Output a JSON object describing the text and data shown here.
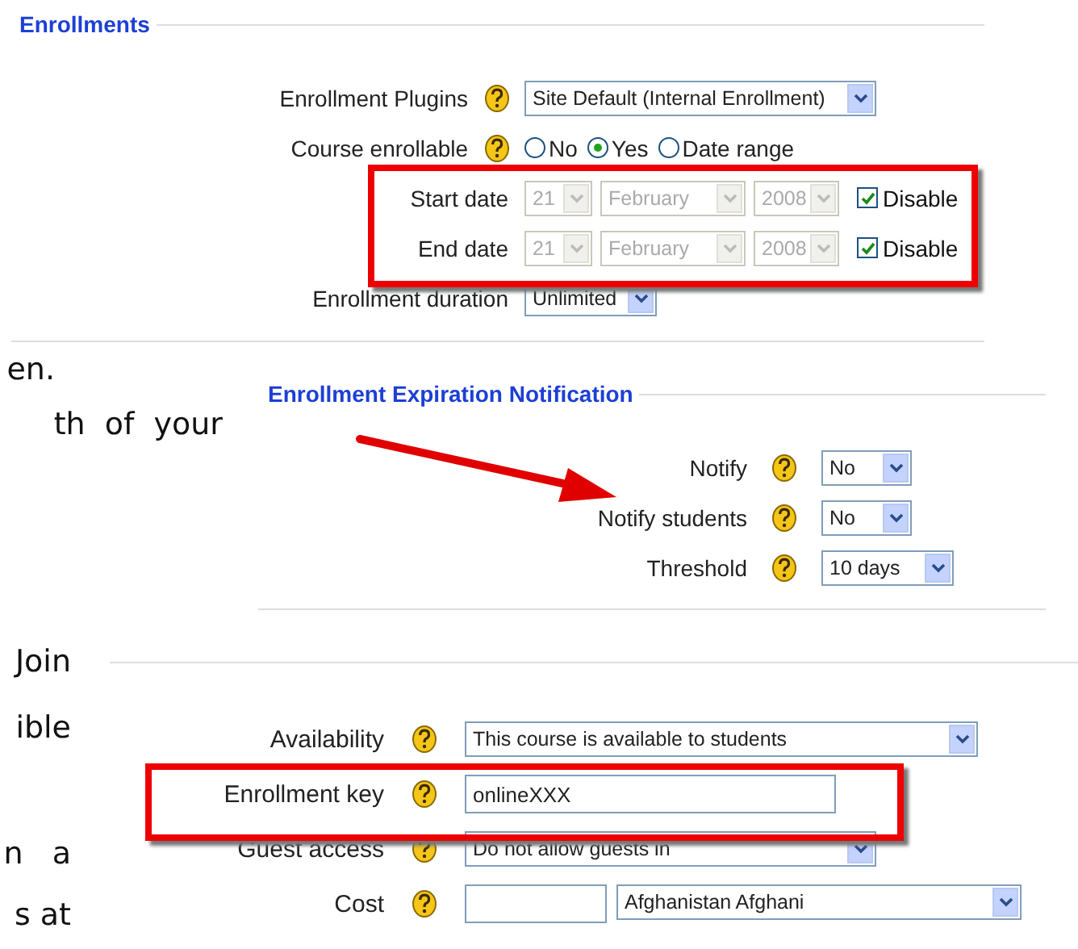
{
  "enrollments": {
    "legend": "Enrollments",
    "plugins": {
      "label": "Enrollment Plugins",
      "value": "Site Default (Internal Enrollment)"
    },
    "enrollable": {
      "label": "Course enrollable",
      "options": [
        {
          "label": "No",
          "selected": false
        },
        {
          "label": "Yes",
          "selected": true
        },
        {
          "label": "Date range",
          "selected": false
        }
      ]
    },
    "dates": [
      {
        "label": "Start date",
        "day": "21",
        "month": "February",
        "year": "2008",
        "disable": {
          "label": "Disable",
          "checked": true
        }
      },
      {
        "label": "End date",
        "day": "21",
        "month": "February",
        "year": "2008",
        "disable": {
          "label": "Disable",
          "checked": true
        }
      }
    ],
    "duration": {
      "label": "Enrollment duration",
      "value": "Unlimited"
    }
  },
  "document_text": [
    "en.",
    "th  of  your",
    "Join",
    "ible",
    "n   a",
    "s at"
  ],
  "expiration": {
    "legend": "Enrollment Expiration Notification",
    "rows": [
      {
        "label": "Notify",
        "value": "No"
      },
      {
        "label": "Notify students",
        "value": "No"
      },
      {
        "label": "Threshold",
        "value": "10 days"
      }
    ]
  },
  "course_settings": {
    "rows": [
      {
        "kind": "select",
        "label": "Availability",
        "value": "This course is available to students"
      },
      {
        "kind": "text",
        "label": "Enrollment key",
        "value": "onlineXXX"
      },
      {
        "kind": "select",
        "label": "Guest access",
        "value": "Do not allow guests in"
      },
      {
        "kind": "cost",
        "label": "Cost",
        "currency": "Afghanistan Afghani"
      }
    ]
  }
}
